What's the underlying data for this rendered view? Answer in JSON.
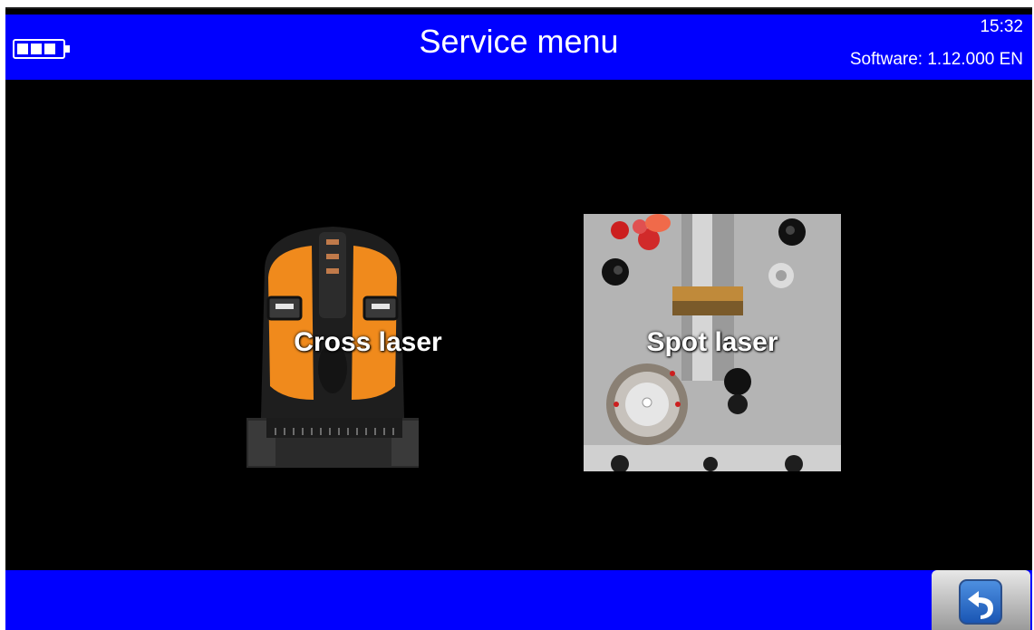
{
  "header": {
    "title": "Service menu",
    "time": "15:32",
    "software": "Software: 1.12.000 EN",
    "battery_icon": "battery-icon",
    "battery_level": 0.75
  },
  "tiles": [
    {
      "label": "Cross laser",
      "image": "cross-laser-device-image"
    },
    {
      "label": "Spot laser",
      "image": "spot-laser-device-image"
    }
  ],
  "footer": {
    "back_icon": "back-arrow-icon"
  },
  "colors": {
    "bar": "#0000ff",
    "background": "#000000",
    "text": "#ffffff",
    "accent_orange": "#f08a1c"
  }
}
